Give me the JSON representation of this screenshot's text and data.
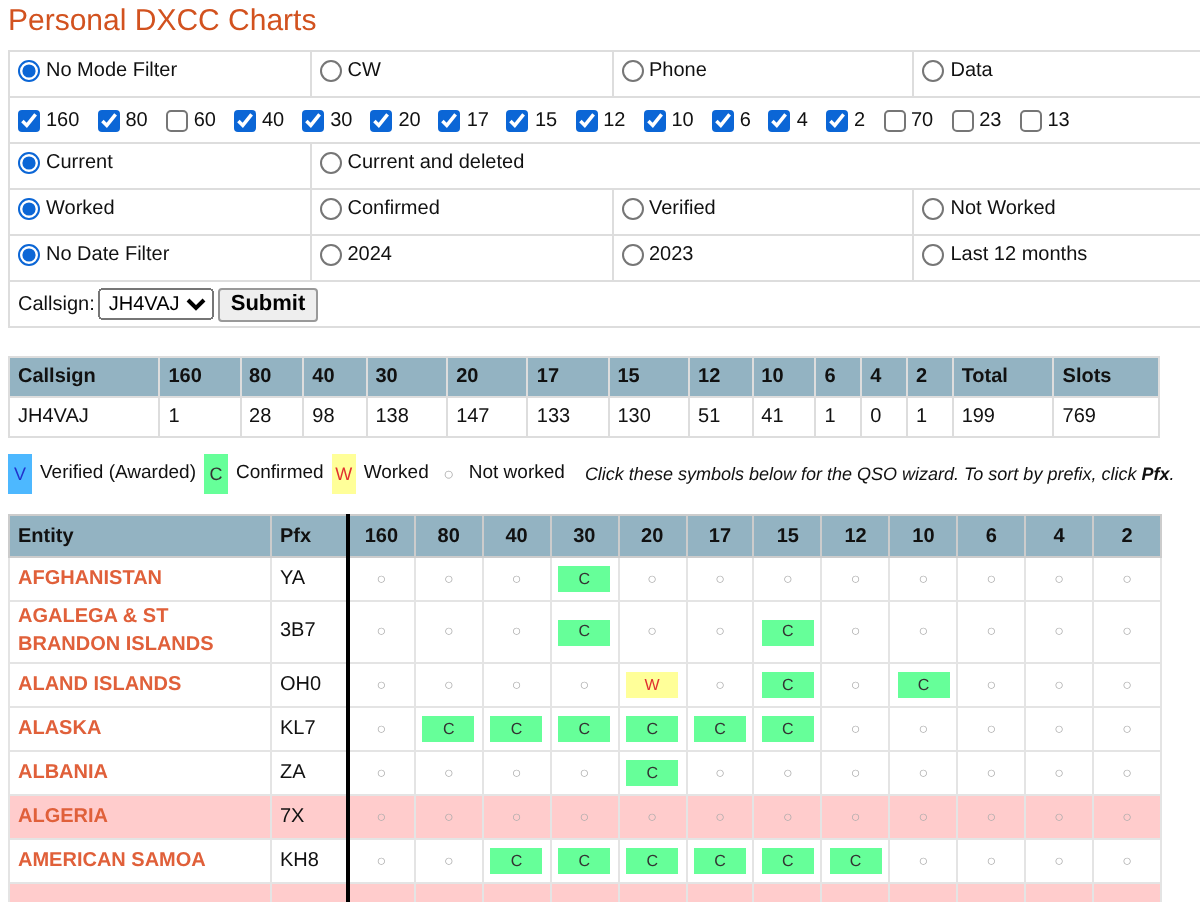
{
  "title": "Personal DXCC Charts",
  "filters": {
    "mode": [
      {
        "label": "No Mode Filter",
        "selected": true
      },
      {
        "label": "CW",
        "selected": false
      },
      {
        "label": "Phone",
        "selected": false
      },
      {
        "label": "Data",
        "selected": false
      }
    ],
    "bands": [
      {
        "label": "160",
        "checked": true
      },
      {
        "label": "80",
        "checked": true
      },
      {
        "label": "60",
        "checked": false
      },
      {
        "label": "40",
        "checked": true
      },
      {
        "label": "30",
        "checked": true
      },
      {
        "label": "20",
        "checked": true
      },
      {
        "label": "17",
        "checked": true
      },
      {
        "label": "15",
        "checked": true
      },
      {
        "label": "12",
        "checked": true
      },
      {
        "label": "10",
        "checked": true
      },
      {
        "label": "6",
        "checked": true
      },
      {
        "label": "4",
        "checked": true
      },
      {
        "label": "2",
        "checked": true
      },
      {
        "label": "70",
        "checked": false
      },
      {
        "label": "23",
        "checked": false
      },
      {
        "label": "13",
        "checked": false
      }
    ],
    "scope": [
      {
        "label": "Current",
        "selected": true
      },
      {
        "label": "Current and deleted",
        "selected": false
      }
    ],
    "status": [
      {
        "label": "Worked",
        "selected": true
      },
      {
        "label": "Confirmed",
        "selected": false
      },
      {
        "label": "Verified",
        "selected": false
      },
      {
        "label": "Not Worked",
        "selected": false
      }
    ],
    "date": [
      {
        "label": "No Date Filter",
        "selected": true
      },
      {
        "label": "2024",
        "selected": false
      },
      {
        "label": "2023",
        "selected": false
      },
      {
        "label": "Last 12 months",
        "selected": false
      }
    ],
    "callsign_label": "Callsign:",
    "callsign": "JH4VAJ",
    "submit": "Submit"
  },
  "summary": {
    "columns": [
      "Callsign",
      "160",
      "80",
      "40",
      "30",
      "20",
      "17",
      "15",
      "12",
      "10",
      "6",
      "4",
      "2",
      "Total",
      "Slots"
    ],
    "rows": [
      [
        "JH4VAJ",
        "1",
        "28",
        "98",
        "138",
        "147",
        "133",
        "130",
        "51",
        "41",
        "1",
        "0",
        "1",
        "199",
        "769"
      ]
    ]
  },
  "legend": [
    {
      "kind": "v",
      "symbol": "V",
      "label": "Verified (Awarded)"
    },
    {
      "kind": "c",
      "symbol": "C",
      "label": "Confirmed"
    },
    {
      "kind": "w",
      "symbol": "W",
      "label": "Worked"
    },
    {
      "kind": "n",
      "symbol": "○",
      "label": "Not worked"
    }
  ],
  "legend_note": "Click these symbols below for the QSO wizard. To sort by prefix, click **Pfx**.",
  "entities": {
    "columns": [
      "Entity",
      "Pfx",
      "160",
      "80",
      "40",
      "30",
      "20",
      "17",
      "15",
      "12",
      "10",
      "6",
      "4",
      "2"
    ],
    "rows": [
      {
        "deleted": false,
        "cells": [
          {
            "kind": "entity",
            "t": "AFGHANISTAN"
          },
          {
            "kind": "pfx",
            "t": "YA"
          },
          {
            "kind": "n",
            "t": "○"
          },
          {
            "kind": "n",
            "t": "○"
          },
          {
            "kind": "n",
            "t": "○"
          },
          {
            "kind": "c",
            "t": "C"
          },
          {
            "kind": "n",
            "t": "○"
          },
          {
            "kind": "n",
            "t": "○"
          },
          {
            "kind": "n",
            "t": "○"
          },
          {
            "kind": "n",
            "t": "○"
          },
          {
            "kind": "n",
            "t": "○"
          },
          {
            "kind": "n",
            "t": "○"
          },
          {
            "kind": "n",
            "t": "○"
          },
          {
            "kind": "n",
            "t": "○"
          }
        ]
      },
      {
        "deleted": false,
        "cells": [
          {
            "kind": "entity",
            "t": "AGALEGA & ST BRANDON ISLANDS"
          },
          {
            "kind": "pfx",
            "t": "3B7"
          },
          {
            "kind": "n",
            "t": "○"
          },
          {
            "kind": "n",
            "t": "○"
          },
          {
            "kind": "n",
            "t": "○"
          },
          {
            "kind": "c",
            "t": "C"
          },
          {
            "kind": "n",
            "t": "○"
          },
          {
            "kind": "n",
            "t": "○"
          },
          {
            "kind": "c",
            "t": "C"
          },
          {
            "kind": "n",
            "t": "○"
          },
          {
            "kind": "n",
            "t": "○"
          },
          {
            "kind": "n",
            "t": "○"
          },
          {
            "kind": "n",
            "t": "○"
          },
          {
            "kind": "n",
            "t": "○"
          }
        ]
      },
      {
        "deleted": false,
        "cells": [
          {
            "kind": "entity",
            "t": "ALAND ISLANDS"
          },
          {
            "kind": "pfx",
            "t": "OH0"
          },
          {
            "kind": "n",
            "t": "○"
          },
          {
            "kind": "n",
            "t": "○"
          },
          {
            "kind": "n",
            "t": "○"
          },
          {
            "kind": "n",
            "t": "○"
          },
          {
            "kind": "w",
            "t": "W"
          },
          {
            "kind": "n",
            "t": "○"
          },
          {
            "kind": "c",
            "t": "C"
          },
          {
            "kind": "n",
            "t": "○"
          },
          {
            "kind": "c",
            "t": "C"
          },
          {
            "kind": "n",
            "t": "○"
          },
          {
            "kind": "n",
            "t": "○"
          },
          {
            "kind": "n",
            "t": "○"
          }
        ]
      },
      {
        "deleted": false,
        "cells": [
          {
            "kind": "entity",
            "t": "ALASKA"
          },
          {
            "kind": "pfx",
            "t": "KL7"
          },
          {
            "kind": "n",
            "t": "○"
          },
          {
            "kind": "c",
            "t": "C"
          },
          {
            "kind": "c",
            "t": "C"
          },
          {
            "kind": "c",
            "t": "C"
          },
          {
            "kind": "c",
            "t": "C"
          },
          {
            "kind": "c",
            "t": "C"
          },
          {
            "kind": "c",
            "t": "C"
          },
          {
            "kind": "n",
            "t": "○"
          },
          {
            "kind": "n",
            "t": "○"
          },
          {
            "kind": "n",
            "t": "○"
          },
          {
            "kind": "n",
            "t": "○"
          },
          {
            "kind": "n",
            "t": "○"
          }
        ]
      },
      {
        "deleted": false,
        "cells": [
          {
            "kind": "entity",
            "t": "ALBANIA"
          },
          {
            "kind": "pfx",
            "t": "ZA"
          },
          {
            "kind": "n",
            "t": "○"
          },
          {
            "kind": "n",
            "t": "○"
          },
          {
            "kind": "n",
            "t": "○"
          },
          {
            "kind": "n",
            "t": "○"
          },
          {
            "kind": "c",
            "t": "C"
          },
          {
            "kind": "n",
            "t": "○"
          },
          {
            "kind": "n",
            "t": "○"
          },
          {
            "kind": "n",
            "t": "○"
          },
          {
            "kind": "n",
            "t": "○"
          },
          {
            "kind": "n",
            "t": "○"
          },
          {
            "kind": "n",
            "t": "○"
          },
          {
            "kind": "n",
            "t": "○"
          }
        ]
      },
      {
        "deleted": true,
        "cells": [
          {
            "kind": "entity",
            "t": "ALGERIA"
          },
          {
            "kind": "pfx",
            "t": "7X"
          },
          {
            "kind": "n",
            "t": "○"
          },
          {
            "kind": "n",
            "t": "○"
          },
          {
            "kind": "n",
            "t": "○"
          },
          {
            "kind": "n",
            "t": "○"
          },
          {
            "kind": "n",
            "t": "○"
          },
          {
            "kind": "n",
            "t": "○"
          },
          {
            "kind": "n",
            "t": "○"
          },
          {
            "kind": "n",
            "t": "○"
          },
          {
            "kind": "n",
            "t": "○"
          },
          {
            "kind": "n",
            "t": "○"
          },
          {
            "kind": "n",
            "t": "○"
          },
          {
            "kind": "n",
            "t": "○"
          }
        ]
      },
      {
        "deleted": false,
        "cells": [
          {
            "kind": "entity",
            "t": "AMERICAN SAMOA"
          },
          {
            "kind": "pfx",
            "t": "KH8"
          },
          {
            "kind": "n",
            "t": "○"
          },
          {
            "kind": "n",
            "t": "○"
          },
          {
            "kind": "c",
            "t": "C"
          },
          {
            "kind": "c",
            "t": "C"
          },
          {
            "kind": "c",
            "t": "C"
          },
          {
            "kind": "c",
            "t": "C"
          },
          {
            "kind": "c",
            "t": "C"
          },
          {
            "kind": "c",
            "t": "C"
          },
          {
            "kind": "n",
            "t": "○"
          },
          {
            "kind": "n",
            "t": "○"
          },
          {
            "kind": "n",
            "t": "○"
          },
          {
            "kind": "n",
            "t": "○"
          }
        ]
      },
      {
        "deleted": true,
        "cells": []
      }
    ]
  }
}
